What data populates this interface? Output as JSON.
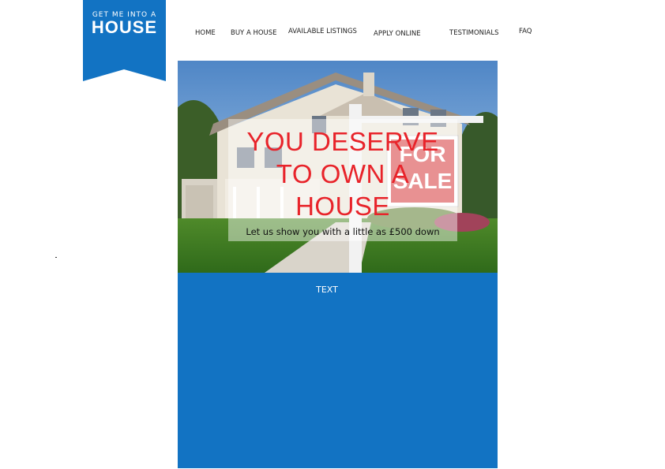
{
  "logo": {
    "line1": "GET ME INTO A",
    "line2": "HOUSE",
    "color": "#1273c3"
  },
  "nav": {
    "items": [
      {
        "label": "HOME"
      },
      {
        "label": "BUY A HOUSE"
      },
      {
        "label": "AVAILABLE LISTINGS"
      },
      {
        "label": "APPLY ONLINE"
      },
      {
        "label": "TESTIMONIALS"
      },
      {
        "label": "FAQ"
      }
    ]
  },
  "hero": {
    "title": "YOU DESERVE TO OWN A HOUSE",
    "subtitle": "Let us show you with a little as £500 down",
    "sign_line1": "FOR",
    "sign_line2": "SALE",
    "title_color": "#e8232a"
  },
  "panel": {
    "text": "TEXT",
    "color": "#1273c3"
  }
}
